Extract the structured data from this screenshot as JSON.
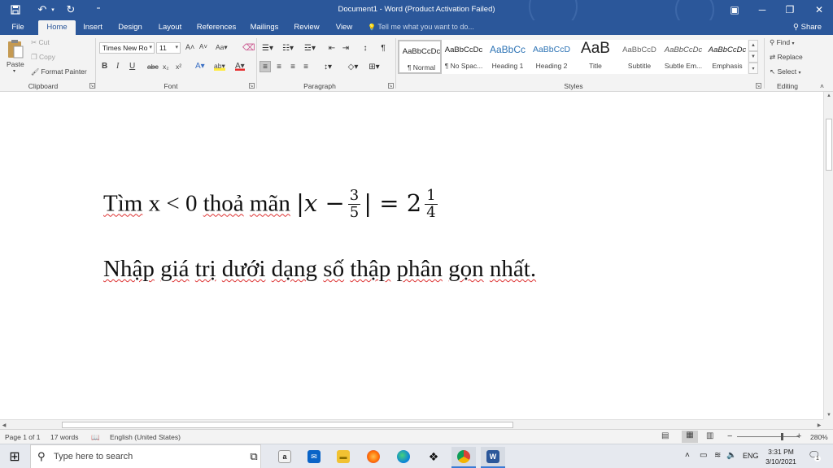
{
  "titlebar": {
    "title": "Document1 - Word (Product Activation Failed)",
    "icons": [
      "save-icon",
      "undo-icon",
      "redo-icon",
      "customize-qat-icon",
      "ribbon-display-icon",
      "minimize-icon",
      "restore-icon",
      "close-icon"
    ],
    "undo_glyph": "↶",
    "undo_arrow": "▾",
    "redo_glyph": "↻",
    "qat_glyph": "⁼",
    "ribbon_display_glyph": "▣",
    "minimize_glyph": "─",
    "restore_glyph": "❐",
    "close_glyph": "✕",
    "accent_color": "#2b579a"
  },
  "tabs": {
    "file": "File",
    "home": "Home",
    "insert": "Insert",
    "design": "Design",
    "layout": "Layout",
    "references": "References",
    "mailings": "Mailings",
    "review": "Review",
    "view": "View",
    "tell_me": "Tell me what you want to do...",
    "tell_me_icon": "💡",
    "share": "Share",
    "share_icon": "⚲"
  },
  "clipboard": {
    "paste": "Paste",
    "paste_arrow": "▾",
    "cut": "Cut",
    "copy": "Copy",
    "format_painter": "Format Painter",
    "cut_glyph": "✂",
    "copy_glyph": "❐",
    "painter_glyph": "🖌",
    "label": "Clipboard"
  },
  "font": {
    "name": "Times New Ro",
    "size": "11",
    "combo_arrow": "▾",
    "grow": "A˄",
    "shrink": "A˅",
    "change_case": "Aa▾",
    "clear_format_glyph": "⌫",
    "bold": "B",
    "italic": "I",
    "underline": "U",
    "strikethrough": "abc",
    "subscript": "x₂",
    "superscript": "x²",
    "text_effects": "A▾",
    "highlight": "ab▾",
    "font_color": "A▾",
    "label": "Font"
  },
  "paragraph": {
    "bullets": "☰▾",
    "numbering": "☷▾",
    "multilevel": "☲▾",
    "decrease_indent": "⇤",
    "increase_indent": "⇥",
    "sort": "↕",
    "show_marks": "¶",
    "align_left": "≡",
    "center": "≡",
    "align_right": "≡",
    "justify": "≡",
    "line_spacing": "↕▾",
    "shading": "◇▾",
    "borders": "⊞▾",
    "label": "Paragraph"
  },
  "styles": {
    "items": [
      {
        "sample": "AaBbCcDc",
        "name": "¶ Normal"
      },
      {
        "sample": "AaBbCcDc",
        "name": "¶ No Spac..."
      },
      {
        "sample": "AaBbCc",
        "name": "Heading 1"
      },
      {
        "sample": "AaBbCcD",
        "name": "Heading 2"
      },
      {
        "sample": "AaB",
        "name": "Title"
      },
      {
        "sample": "AaBbCcD",
        "name": "Subtitle"
      },
      {
        "sample": "AaBbCcDc",
        "name": "Subtle Em..."
      },
      {
        "sample": "AaBbCcDc",
        "name": "Emphasis"
      }
    ],
    "scroll_up": "▲",
    "scroll_down": "▼",
    "more": "▾",
    "label": "Styles",
    "heading_color": "#2e74b5"
  },
  "editing": {
    "find": "Find",
    "find_arrow": "▾",
    "find_glyph": "⚲",
    "replace": "Replace",
    "replace_glyph": "⇄",
    "select": "Select",
    "select_arrow": "▾",
    "select_glyph": "↖",
    "label": "Editing",
    "collapse_glyph": "˄"
  },
  "launcher_glyph": "↘",
  "document": {
    "line1_word_tim": "Tìm",
    "line1_x": "x",
    "line1_lt": "<",
    "line1_zero": "0",
    "line1_thoa": "thoả",
    "line1_man": "mãn",
    "math_abs_open": "|",
    "math_var": "x",
    "math_minus": "−",
    "math_frac1_num": "3",
    "math_frac1_den": "5",
    "math_abs_close": "|",
    "math_eq": "=",
    "math_whole": "2",
    "math_frac2_num": "1",
    "math_frac2_den": "4",
    "line2_words": [
      "Nhập",
      "giá",
      "trị",
      "dưới",
      "dạng",
      "số",
      "thập",
      "phân",
      "gọn",
      "nhất."
    ]
  },
  "scroll": {
    "up": "▲",
    "down": "▼",
    "left": "◀",
    "right": "▶"
  },
  "statusbar": {
    "page": "Page 1 of 1",
    "words": "17 words",
    "proofing_glyph": "📖",
    "language": "English (United States)",
    "view_read_glyph": "▤",
    "view_print_glyph": "▦",
    "view_web_glyph": "▥",
    "zoom_out": "−",
    "zoom_in": "+",
    "zoom_level": 0.72,
    "zoom": "280%"
  },
  "taskbar": {
    "start_glyph": "⊞",
    "search_glyph": "⚲",
    "search_placeholder": "Type here to search",
    "task_view_glyph": "⧉",
    "apps": [
      "amazon-icon",
      "mail-icon",
      "file-explorer-icon",
      "firefox-icon",
      "edge-icon",
      "dropbox-icon",
      "chrome-icon",
      "word-icon"
    ],
    "amazon_text": "a",
    "mail_text": "✉",
    "explorer_text": "▬",
    "dropbox_text": "❖",
    "word_text": "W",
    "tray_chevron": "˄",
    "tray_battery": "▭",
    "tray_wifi": "≋",
    "tray_volume": "🔈",
    "language": "ENG",
    "time": "3:31 PM",
    "date": "3/10/2021",
    "notifications_glyph": "🗨",
    "notification_count": "1"
  }
}
